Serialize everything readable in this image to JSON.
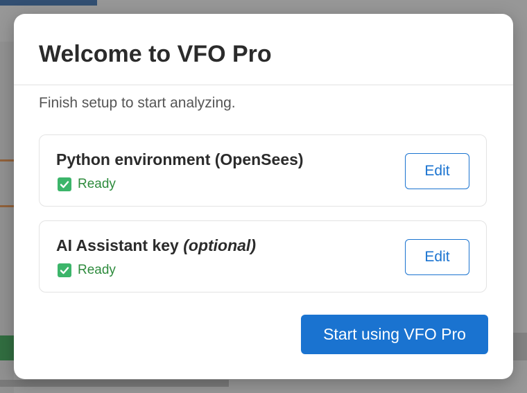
{
  "dialog": {
    "title": "Welcome to VFO Pro",
    "subtitle": "Finish setup to start analyzing."
  },
  "items": [
    {
      "title": "Python environment (OpenSees)",
      "title_suffix": "",
      "status": "Ready",
      "status_icon": "check-icon",
      "edit_label": "Edit"
    },
    {
      "title": "AI Assistant key ",
      "title_suffix": "(optional)",
      "status": "Ready",
      "status_icon": "check-icon",
      "edit_label": "Edit"
    }
  ],
  "primary_button": {
    "label": "Start using VFO Pro"
  },
  "colors": {
    "accent": "#1a73d0",
    "status_ok": "#2e8b3d",
    "check_bg": "#3cb56a"
  }
}
